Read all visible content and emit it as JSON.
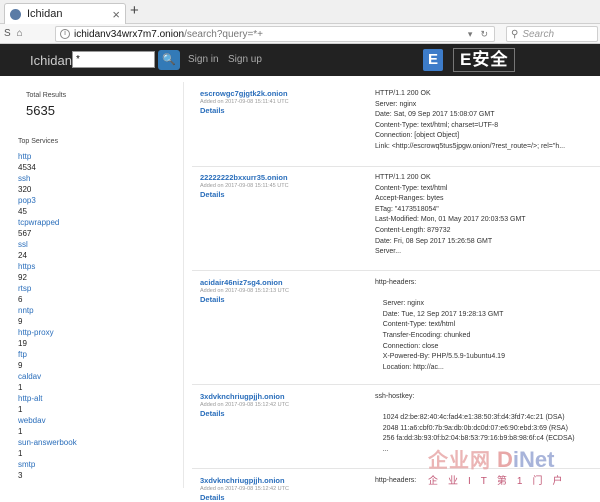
{
  "browser": {
    "tab_title": "Ichidan",
    "new_tab": "+",
    "url_host": "ichidanv34wrx7m7.onion",
    "url_path": "/search?query=*+",
    "search_placeholder": "Search",
    "nav_back": "S",
    "nav_home": "⌂"
  },
  "site": {
    "logo": "Ichidan",
    "query_value": "*",
    "search_btn": "🔍",
    "sign_in": "Sign in",
    "sign_up": "Sign up",
    "brand_e": "E",
    "brand_cn": "E安全"
  },
  "sidebar": {
    "total_label": "Total Results",
    "total_value": "5635",
    "top_label": "Top Services",
    "services": [
      {
        "name": "http",
        "count": "4534"
      },
      {
        "name": "ssh",
        "count": "320"
      },
      {
        "name": "pop3",
        "count": "45"
      },
      {
        "name": "tcpwrapped",
        "count": "567"
      },
      {
        "name": "ssl",
        "count": "24"
      },
      {
        "name": "https",
        "count": "92"
      },
      {
        "name": "rtsp",
        "count": "6"
      },
      {
        "name": "nntp",
        "count": "9"
      },
      {
        "name": "http-proxy",
        "count": "19"
      },
      {
        "name": "ftp",
        "count": "9"
      },
      {
        "name": "caldav",
        "count": "1"
      },
      {
        "name": "http-alt",
        "count": "1"
      },
      {
        "name": "webdav",
        "count": "1"
      },
      {
        "name": "sun-answerbook",
        "count": "1"
      },
      {
        "name": "smtp",
        "count": "3"
      }
    ]
  },
  "results": [
    {
      "host": "escrowgc7gjgtk2k.onion",
      "added": "Added on 2017-09-08 15:11:41 UTC",
      "details": "Details",
      "banner": "HTTP/1.1 200 OK\nServer: nginx\nDate: Sat, 09 Sep 2017 15:08:07 GMT\nContent-Type: text/html; charset=UTF-8\nConnection: [object Object]\nLink: <http://escrowq5tus5jpgw.onion/?rest_route=/>; rel=\"h..."
    },
    {
      "host": "22222222bxxurr35.onion",
      "added": "Added on 2017-09-08 15:11:45 UTC",
      "details": "Details",
      "banner": "HTTP/1.1 200 OK\nContent-Type: text/html\nAccept-Ranges: bytes\nETag: \"4173518054\"\nLast-Modified: Mon, 01 May 2017 20:03:53 GMT\nContent-Length: 879732\nDate: Fri, 08 Sep 2017 15:26:58 GMT\nServer..."
    },
    {
      "host": "acidair46niz7sg4.onion",
      "added": "Added on 2017-09-08 15:12:13 UTC",
      "details": "Details",
      "banner": "http-headers:\n\n    Server: nginx\n    Date: Tue, 12 Sep 2017 19:28:13 GMT\n    Content-Type: text/html\n    Transfer-Encoding: chunked\n    Connection: close\n    X-Powered-By: PHP/5.5.9-1ubuntu4.19\n    Location: http://ac..."
    },
    {
      "host": "3xdvknchriugpjjh.onion",
      "added": "Added on 2017-09-08 15:12:42 UTC",
      "details": "Details",
      "banner": "ssh-hostkey:\n\n    1024 d2:be:82:40:4c:fad4:e1:38:50:3f:d4:3fd7:4c:21 (DSA)\n    2048 11:a6:cbf0:7b:9a:db:0b:dc0d:07:e6:90:ebd:3:69 (RSA)\n    256 fa:dd:3b:93:0f:b2:04:b8:53:79:16:b9:b8:98:6f:c4 (ECDSA)\n    ..."
    },
    {
      "host": "3xdvknchriugpjjh.onion",
      "added": "Added on 2017-09-08 15:12:42 UTC",
      "details": "Details",
      "banner": "http-headers:"
    }
  ],
  "watermark": {
    "cn": "企业网",
    "di": "D",
    "net": "iNet",
    "sub": "企业IT第1门户"
  }
}
